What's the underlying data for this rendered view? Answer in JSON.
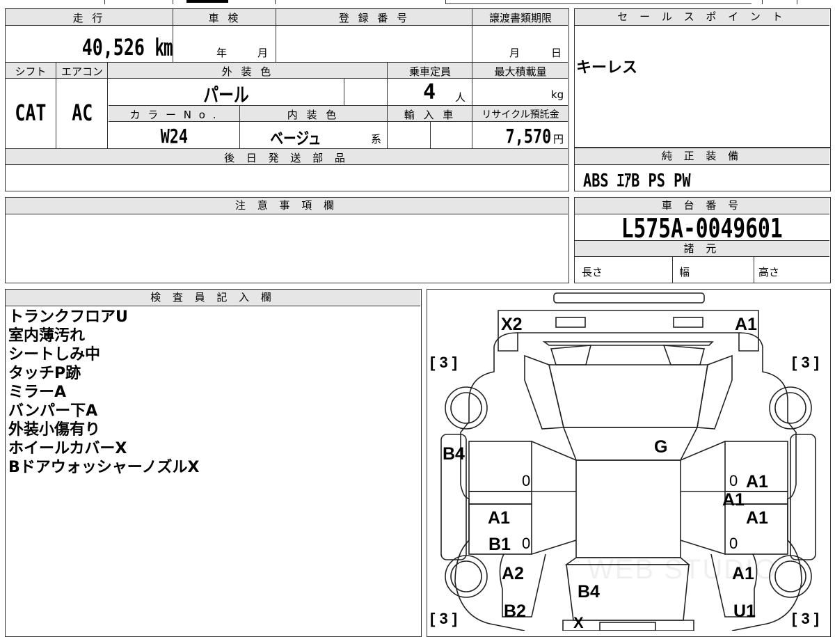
{
  "top": {
    "mileage_header": "走 行",
    "mileage_value": "40,526 ㎞",
    "inspection_header": "車 検",
    "inspection_year": "年",
    "inspection_month": "月",
    "reg_header": "登 録 番 号",
    "transfer_header": "譲渡書類期限",
    "transfer_month": "月",
    "transfer_day": "日",
    "shift_header": "シフト",
    "shift_value": "CAT",
    "ac_header": "エアコン",
    "ac_value": "AC",
    "exterior_header": "外 装 色",
    "exterior_value": "パール",
    "capacity_header": "乗車定員",
    "capacity_value": "4",
    "capacity_unit": "人",
    "load_header": "最大積載量",
    "load_unit": "kg",
    "color_no_header": "カ ラ ー N o .",
    "color_no_value": "W24",
    "interior_header": "内 装 色",
    "interior_value": "ベージュ",
    "interior_suffix": "系",
    "import_header": "輸 入 車",
    "recycle_header": "リサイクル預託金",
    "recycle_value": "7,570",
    "recycle_unit": "円",
    "later_parts_header": "後 日 発 送 部 品"
  },
  "sale_points": {
    "header": "セ ー ル ス ポ イ ン ト",
    "text": "キーレス"
  },
  "genuine_equipment": {
    "header": "純 正 装 備",
    "text": "ABS ｴｱB PS PW"
  },
  "caution": {
    "header": "注 意 事 項 欄"
  },
  "chassis": {
    "header": "車 台 番 号",
    "value": "L575A-0049601",
    "spec_header": "諸 元",
    "length_label": "長さ",
    "width_label": "幅",
    "height_label": "高さ"
  },
  "inspector": {
    "header": "検 査 員 記 入 欄",
    "notes": [
      "トランクフロアU",
      "室内薄汚れ",
      "シートしみ中",
      "タッチP跡",
      "ミラーA",
      "バンパー下A",
      "外装小傷有り",
      "ホイールカバーX",
      "BドアウォッシャーノズルX"
    ]
  },
  "diagram": {
    "labels": {
      "rear_left": "X2",
      "rear_right": "A1",
      "tire_rl": "[ 3 ]",
      "tire_rr": "[ 3 ]",
      "tire_fl": "[ 3 ]",
      "tire_fr": "[ 3 ]",
      "quarter_left": "B4",
      "roof": "G",
      "door_right_rear": "A1",
      "pillar_right": "A1",
      "door_left_front": "A1",
      "door_right_front": "A1",
      "sill_left": "B1",
      "fender_left": "A2",
      "fender_right": "A1",
      "hood": "B4",
      "bumper_left": "B2",
      "bumper_right": "U1",
      "front_center": "X",
      "zero_1": "0",
      "zero_2": "0",
      "zero_3": "0",
      "zero_4": "0"
    },
    "watermark": "WEB STUDIO"
  }
}
